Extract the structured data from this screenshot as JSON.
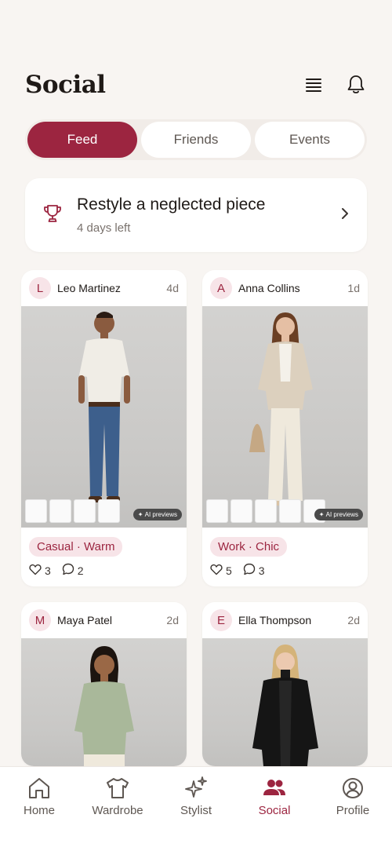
{
  "page_title": "Social",
  "tabs": [
    {
      "label": "Feed",
      "active": true
    },
    {
      "label": "Friends",
      "active": false
    },
    {
      "label": "Events",
      "active": false
    }
  ],
  "challenge": {
    "title": "Restyle a neglected piece",
    "subtitle": "4 days left",
    "icon": "trophy-icon"
  },
  "posts": [
    {
      "initial": "L",
      "name": "Leo Martinez",
      "age": "4d",
      "tag": "Casual · Warm",
      "likes": "3",
      "comments": "2",
      "ai_label": "AI previews"
    },
    {
      "initial": "A",
      "name": "Anna Collins",
      "age": "1d",
      "tag": "Work · Chic",
      "likes": "5",
      "comments": "3",
      "ai_label": "AI previews"
    },
    {
      "initial": "M",
      "name": "Maya Patel",
      "age": "2d"
    },
    {
      "initial": "E",
      "name": "Ella Thompson",
      "age": "2d"
    }
  ],
  "nav": [
    {
      "label": "Home",
      "icon": "home-icon",
      "active": false
    },
    {
      "label": "Wardrobe",
      "icon": "tshirt-icon",
      "active": false
    },
    {
      "label": "Stylist",
      "icon": "sparkle-icon",
      "active": false
    },
    {
      "label": "Social",
      "icon": "people-icon",
      "active": true
    },
    {
      "label": "Profile",
      "icon": "profile-icon",
      "active": false
    }
  ],
  "colors": {
    "accent": "#9c2540",
    "accent_soft": "#f7e4e8",
    "background": "#f8f5f2"
  }
}
